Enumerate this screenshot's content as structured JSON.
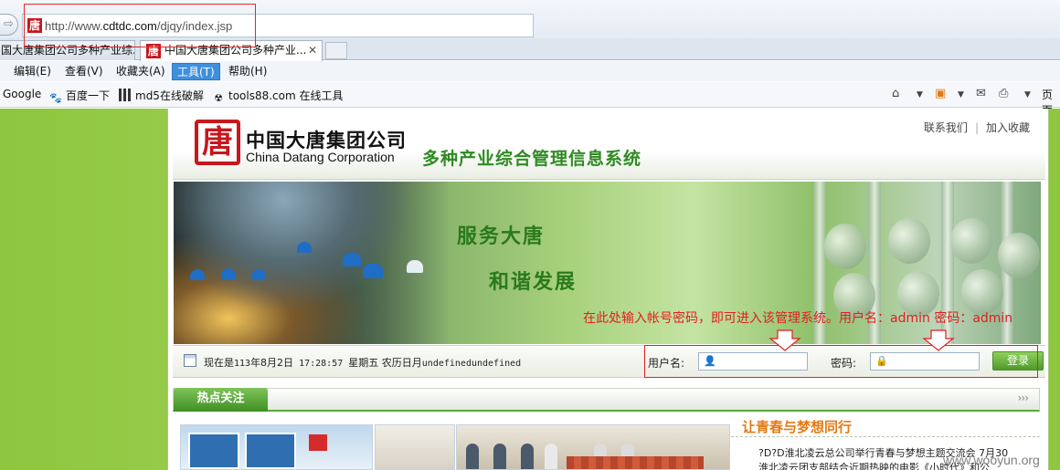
{
  "browser": {
    "url_prefix": "http://www.",
    "url_domain": "cdtdc.com",
    "url_path": "/djqy/index.jsp",
    "favicon_glyph": "唐",
    "back_glyph": "⇨",
    "tabs": [
      {
        "label": "国大唐集团公司多种产业综..."
      },
      {
        "label": "中国大唐集团公司多种产业...",
        "close": "✕"
      }
    ],
    "menu": [
      "编辑(E)",
      "查看(V)",
      "收藏夹(A)",
      "工具(T)",
      "帮助(H)"
    ],
    "active_menu_index": 3,
    "favorites": [
      {
        "label": "Google",
        "icon": ""
      },
      {
        "label": "百度一下",
        "icon": "paw-icon"
      },
      {
        "label": "md5在线破解",
        "icon": "grid-icon"
      },
      {
        "label": "tools88.com 在线工具",
        "icon": "radiation-icon"
      }
    ],
    "command_page_label": "页面"
  },
  "site": {
    "logo_glyph": "唐",
    "logo_cn": "中国大唐集团公司",
    "logo_en": "China Datang Corporation",
    "system_title": "多种产业综合管理信息系统",
    "top_links": [
      "联系我们",
      "加入收藏"
    ],
    "top_link_sep": "|",
    "banner": {
      "slogan_1": "服务大唐",
      "slogan_2": "和谐发展",
      "annotation": "在此处输入帐号密码，即可进入该管理系统。用户名：admin  密码：admin"
    },
    "datetime_prefix": "现在是",
    "datetime_year": "113",
    "datetime_date": "年8月2日",
    "datetime_time": " 17:28:57 ",
    "datetime_weekday": "星期五",
    "datetime_lunar": "  农历日月",
    "datetime_tail": "undefinedundefined",
    "login": {
      "username_label": "用户名:",
      "password_label": "密码:",
      "submit_label": "登录",
      "username_value": "",
      "password_value": ""
    },
    "hot_tab": "热点关注",
    "hot_more": "›››",
    "news": {
      "title": "让青春与梦想同行",
      "items": [
        "?D?D淮北凌云总公司举行青春与梦想主题交流会  7月30",
        "淮北凌云团支部结合近期热映的电影《小时代》和公"
      ]
    }
  },
  "watermark": "www.wooyun.org",
  "colors": {
    "brand_red": "#c8161d",
    "brand_green": "#2e8b22",
    "annotation_red": "#e11f1f",
    "news_orange": "#e47a14"
  }
}
